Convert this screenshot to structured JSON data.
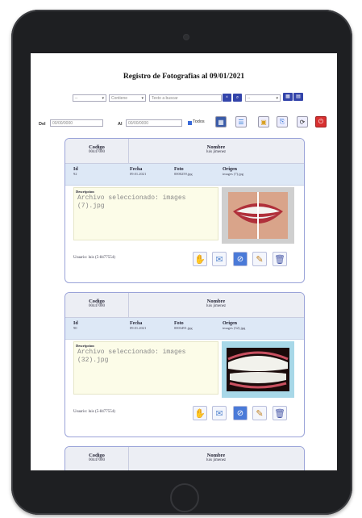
{
  "page_title": "Registro de Fotografias al 09/01/2021",
  "filters": {
    "select_1": "--",
    "select_2": "Contiene",
    "search_placeholder": "Texto a buscar",
    "select_3": "--",
    "date_from_label": "Del",
    "date_from_value": "00/00/0000",
    "date_to_label": "Al",
    "date_to_value": "00/00/0000",
    "all_label": "Todos"
  },
  "records": [
    {
      "codigo_label": "Codigo",
      "codigo_value": "00447000",
      "nombre_label": "Nombre",
      "nombre_value": "luis jimenez",
      "id_label": "Id",
      "id_value": "92",
      "fecha_label": "Fecha",
      "fecha_value": "09.01.2021",
      "foto_label": "Foto",
      "foto_value": "0000259.jpg",
      "origen_label": "Origen",
      "origen_value": "images (7).jpg",
      "descripcion_label": "Descripcion",
      "descripcion_value": "Archivo seleccionado: images (7).jpg",
      "usuario": "Usuario: luis (5-8477554)"
    },
    {
      "codigo_label": "Codigo",
      "codigo_value": "00447000",
      "nombre_label": "Nombre",
      "nombre_value": "luis jimenez",
      "id_label": "Id",
      "id_value": "90",
      "fecha_label": "Fecha",
      "fecha_value": "09.01.2021",
      "foto_label": "Foto",
      "foto_value": "0003491.jpg",
      "origen_label": "Origen",
      "origen_value": "images (32).jpg",
      "descripcion_label": "Descripcion",
      "descripcion_value": "Archivo seleccionado: images (32).jpg",
      "usuario": "Usuario: luis (5-8477554)"
    },
    {
      "codigo_label": "Codigo",
      "codigo_value": "00447000",
      "nombre_label": "Nombre",
      "nombre_value": "luis jimenez"
    }
  ],
  "colors": {
    "card_border": "#9aa3d8",
    "meta_bg": "#dde8f6",
    "desc_bg": "#fcfce8",
    "accent_blue": "#3344aa",
    "device": "#1e1f22"
  }
}
